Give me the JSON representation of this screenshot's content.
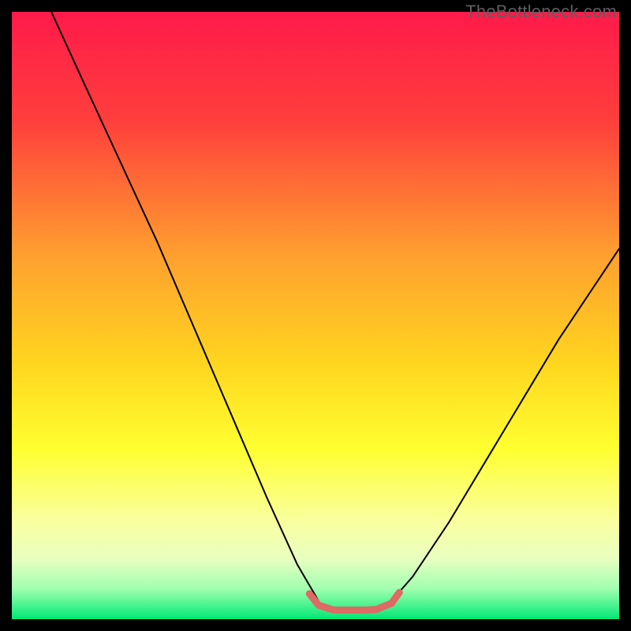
{
  "watermark": "TheBottleneck.com",
  "chart_data": {
    "type": "line",
    "title": "",
    "xlabel": "",
    "ylabel": "",
    "xlim": [
      0,
      100
    ],
    "ylim": [
      0,
      100
    ],
    "grid": false,
    "legend": false,
    "gradient_stops": [
      {
        "pos": 0.0,
        "color": "#ff1a4a"
      },
      {
        "pos": 0.18,
        "color": "#ff3f3c"
      },
      {
        "pos": 0.4,
        "color": "#ff9f2f"
      },
      {
        "pos": 0.58,
        "color": "#ffd61f"
      },
      {
        "pos": 0.72,
        "color": "#ffff30"
      },
      {
        "pos": 0.84,
        "color": "#f9ffa0"
      },
      {
        "pos": 0.9,
        "color": "#e9ffc0"
      },
      {
        "pos": 0.95,
        "color": "#a0ffb0"
      },
      {
        "pos": 1.0,
        "color": "#00e874"
      }
    ],
    "series": [
      {
        "name": "left-curve",
        "color": "#000000",
        "width": 2,
        "x": [
          6.5,
          12,
          18,
          24,
          30,
          36,
          42,
          47,
          50.5
        ],
        "values": [
          100,
          88,
          75,
          62,
          48,
          34,
          20,
          9,
          3.0
        ]
      },
      {
        "name": "right-curve",
        "color": "#000000",
        "width": 2,
        "x": [
          62.5,
          66,
          72,
          78,
          84,
          90,
          96,
          100
        ],
        "values": [
          3.0,
          7,
          16,
          26,
          36,
          46,
          55,
          61
        ]
      },
      {
        "name": "bottom-highlight",
        "color": "#dd6a64",
        "width": 9,
        "x": [
          49.0,
          50.5,
          53,
          56,
          58,
          60,
          62.5,
          63.8
        ],
        "values": [
          4.2,
          2.3,
          1.5,
          1.5,
          1.5,
          1.6,
          2.6,
          4.4
        ]
      }
    ],
    "annotations": []
  }
}
